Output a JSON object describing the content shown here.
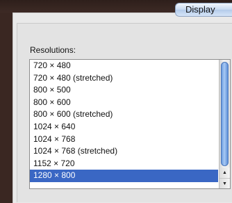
{
  "tab": {
    "label": "Display"
  },
  "resolutions": {
    "label": "Resolutions:",
    "items": [
      "720 × 480",
      "720 × 480 (stretched)",
      "800 × 500",
      "800 × 600",
      "800 × 600 (stretched)",
      "1024 × 640",
      "1024 × 768",
      "1024 × 768 (stretched)",
      "1152 × 720",
      "1280 × 800"
    ],
    "selected": "1280 × 800"
  },
  "scrollbar": {
    "up_icon": "scroll-up-arrow-icon",
    "down_icon": "scroll-down-arrow-icon"
  }
}
